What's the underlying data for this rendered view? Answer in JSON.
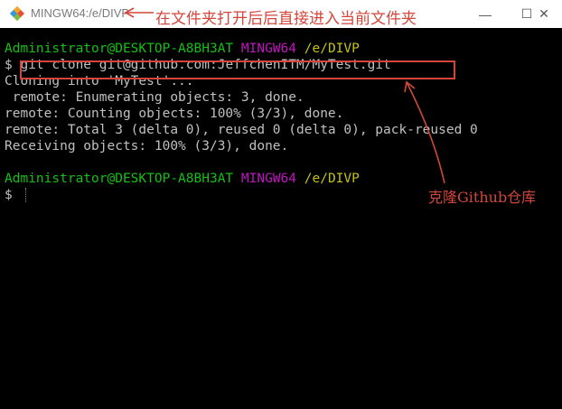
{
  "window": {
    "title": "MINGW64:/e/DIVP",
    "icon": "git-bash-icon",
    "controls": {
      "minimize": "—",
      "maximize": "☐",
      "close": "✕"
    }
  },
  "terminal": {
    "prompt1": {
      "user_host": "Administrator@DESKTOP-A8BH3AT",
      "shell": "MINGW64",
      "path": "/e/DIVP"
    },
    "command": {
      "dollar": "$",
      "text": "git clone git@github.com:JeffchenITM/MyTest.git"
    },
    "output": [
      "Cloning into 'MyTest'...",
      " remote: Enumerating objects: 3, done.",
      "remote: Counting objects: 100% (3/3), done.",
      "remote: Total 3 (delta 0), reused 0 (delta 0), pack-reused 0",
      "Receiving objects: 100% (3/3), done."
    ],
    "prompt2": {
      "user_host": "Administrator@DESKTOP-A8BH3AT",
      "shell": "MINGW64",
      "path": "/e/DIVP"
    },
    "dollar2": "$"
  },
  "annotations": {
    "top": "在文件夹打开后后直接进入当前文件夹",
    "bottom": "克隆Github仓库",
    "color": "#d4463b"
  }
}
